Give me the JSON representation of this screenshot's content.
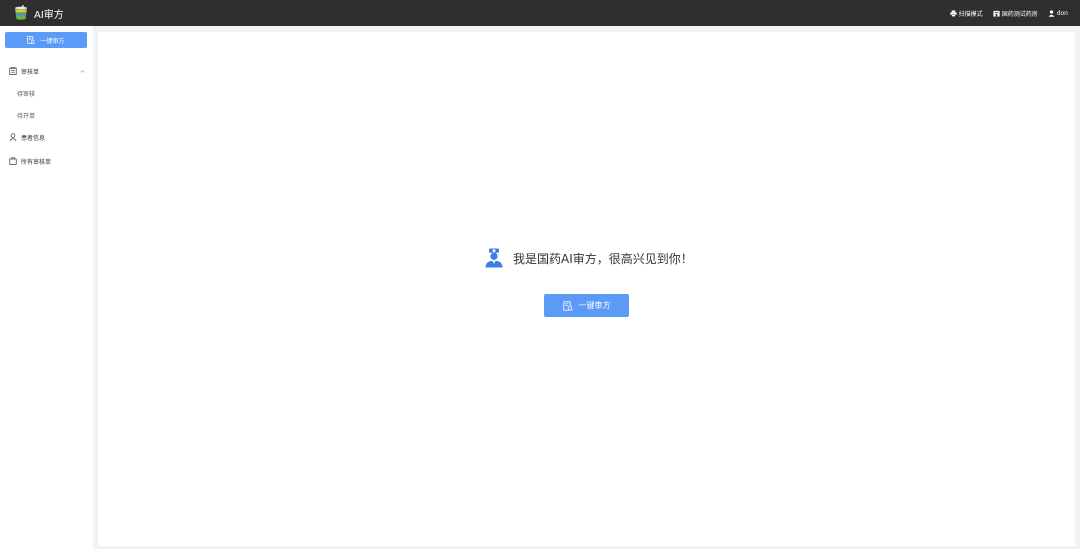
{
  "header": {
    "app_title": "AI审方",
    "logo_icon": "drink-cup-logo",
    "right_items": [
      {
        "label": "扫描模式",
        "icon": "printer-icon"
      },
      {
        "label": "国药测试药房",
        "icon": "store-icon"
      },
      {
        "label": "don",
        "icon": "user-icon"
      }
    ]
  },
  "sidebar": {
    "action_button": "一键审方",
    "menu": {
      "review_group": {
        "label": "审核单",
        "expanded": true,
        "children": [
          "待审核",
          "待开单"
        ]
      },
      "patient_info": "患者信息",
      "all_reviews": "所有审核单"
    }
  },
  "main": {
    "welcome_text": "我是国药AI审方，很高兴见到你！",
    "action_button": "一键审方"
  },
  "colors": {
    "topbar": "#2f2f2f",
    "accent": "#5b9bf7",
    "background": "#f0f2f5",
    "panel": "#ffffff"
  }
}
